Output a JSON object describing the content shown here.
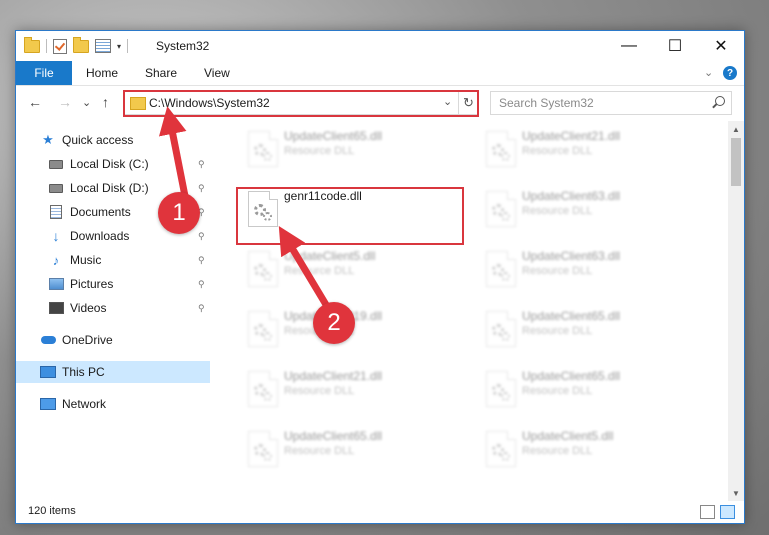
{
  "window": {
    "title": "System32",
    "minimize_glyph": "—",
    "maximize_glyph": "☐",
    "close_glyph": "✕"
  },
  "ribbon": {
    "tabs": [
      "File",
      "Home",
      "Share",
      "View"
    ],
    "expand_glyph": "⌄",
    "help_glyph": "?"
  },
  "nav": {
    "back_glyph": "←",
    "forward_glyph": "→",
    "recent_glyph": "⌄",
    "up_glyph": "↑",
    "address": "C:\\Windows\\System32",
    "address_drop_glyph": "⌄",
    "refresh_glyph": "↻",
    "search_placeholder": "Search System32"
  },
  "sidebar": {
    "quick_access": "Quick access",
    "items": [
      {
        "label": "Local Disk (C:)",
        "icon": "drive-icon",
        "pinned": true
      },
      {
        "label": "Local Disk (D:)",
        "icon": "drive-icon",
        "pinned": true
      },
      {
        "label": "Documents",
        "icon": "documents-icon",
        "pinned": true
      },
      {
        "label": "Downloads",
        "icon": "downloads-icon",
        "pinned": true
      },
      {
        "label": "Music",
        "icon": "music-icon",
        "pinned": true
      },
      {
        "label": "Pictures",
        "icon": "pictures-icon",
        "pinned": true
      },
      {
        "label": "Videos",
        "icon": "videos-icon",
        "pinned": true
      }
    ],
    "onedrive": "OneDrive",
    "this_pc": "This PC",
    "network": "Network",
    "pin_glyph": "📌"
  },
  "files": {
    "left": [
      {
        "name": "UpdateClient65.dll",
        "type": "Resource DLL"
      },
      {
        "name": "genr11code.dll",
        "type": ""
      },
      {
        "name": "UpdateClient5.dll",
        "type": "Resource DLL"
      },
      {
        "name": "UpdateClient19.dll",
        "type": "Resource DLL"
      },
      {
        "name": "UpdateClient21.dll",
        "type": "Resource DLL"
      },
      {
        "name": "UpdateClient65.dll",
        "type": "Resource DLL"
      }
    ],
    "right": [
      {
        "name": "UpdateClient21.dll",
        "type": "Resource DLL"
      },
      {
        "name": "UpdateClient63.dll",
        "type": "Resource DLL"
      },
      {
        "name": "UpdateClient63.dll",
        "type": "Resource DLL"
      },
      {
        "name": "UpdateClient65.dll",
        "type": "Resource DLL"
      },
      {
        "name": "UpdateClient65.dll",
        "type": "Resource DLL"
      },
      {
        "name": "UpdateClient5.dll",
        "type": "Resource DLL"
      }
    ]
  },
  "status": {
    "items_count": "120 items"
  },
  "annotations": {
    "step1": "1",
    "step2": "2",
    "color": "#e0343c"
  }
}
